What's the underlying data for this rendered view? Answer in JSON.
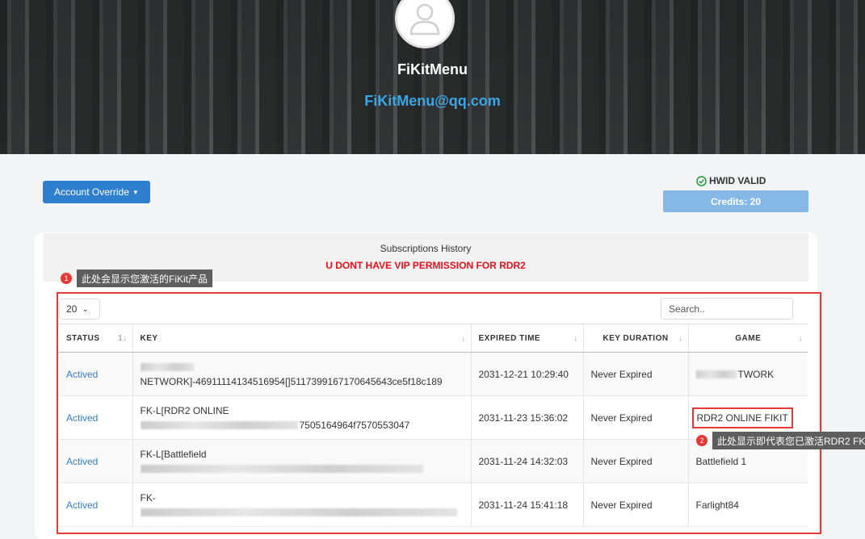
{
  "profile": {
    "username": "FiKitMenu",
    "email": "FiKitMenu@qq.com"
  },
  "toolbar": {
    "override_label": "Account Override",
    "hwid_label": "HWID VALID",
    "credits_label": "Credits: 20"
  },
  "subscriptions": {
    "title": "Subscriptions History",
    "warning": "U DONT HAVE VIP PERMISSION FOR RDR2"
  },
  "annotations": [
    {
      "number": "1",
      "text": "此处会显示您激活的FiKit产品"
    },
    {
      "number": "2",
      "text": "此处显示即代表您已激活RDR2 FK"
    }
  ],
  "table": {
    "page_size": "20",
    "search_placeholder": "Search..",
    "columns": [
      "STATUS",
      "KEY",
      "EXPIRED TIME",
      "KEY DURATION",
      "GAME"
    ],
    "rows": [
      {
        "status": "Actived",
        "key_line1": "",
        "key_line2": "NETWORK]-46911114134516954[]5117399167170645643ce5f18c189",
        "expired": "2031-12-21 10:29:40",
        "duration": "Never Expired",
        "game": "TWORK"
      },
      {
        "status": "Actived",
        "key_line1": "FK-L[RDR2 ONLINE",
        "key_line2": "7505164964f7570553047",
        "expired": "2031-11-23 15:36:02",
        "duration": "Never Expired",
        "game": "RDR2 ONLINE FIKIT"
      },
      {
        "status": "Actived",
        "key_line1": "FK-L[Battlefield",
        "key_line2": "",
        "expired": "2031-11-24 14:32:03",
        "duration": "Never Expired",
        "game": "Battlefield 1"
      },
      {
        "status": "Actived",
        "key_line1": "FK-",
        "key_line2": "",
        "expired": "2031-11-24 15:41:18",
        "duration": "Never Expired",
        "game": "Farlight84"
      }
    ]
  },
  "colors": {
    "primary": "#2f7fcf",
    "credits": "#85b8e6",
    "warning": "#e8101a",
    "annotation": "#e53935",
    "email": "#3aa6e6"
  }
}
